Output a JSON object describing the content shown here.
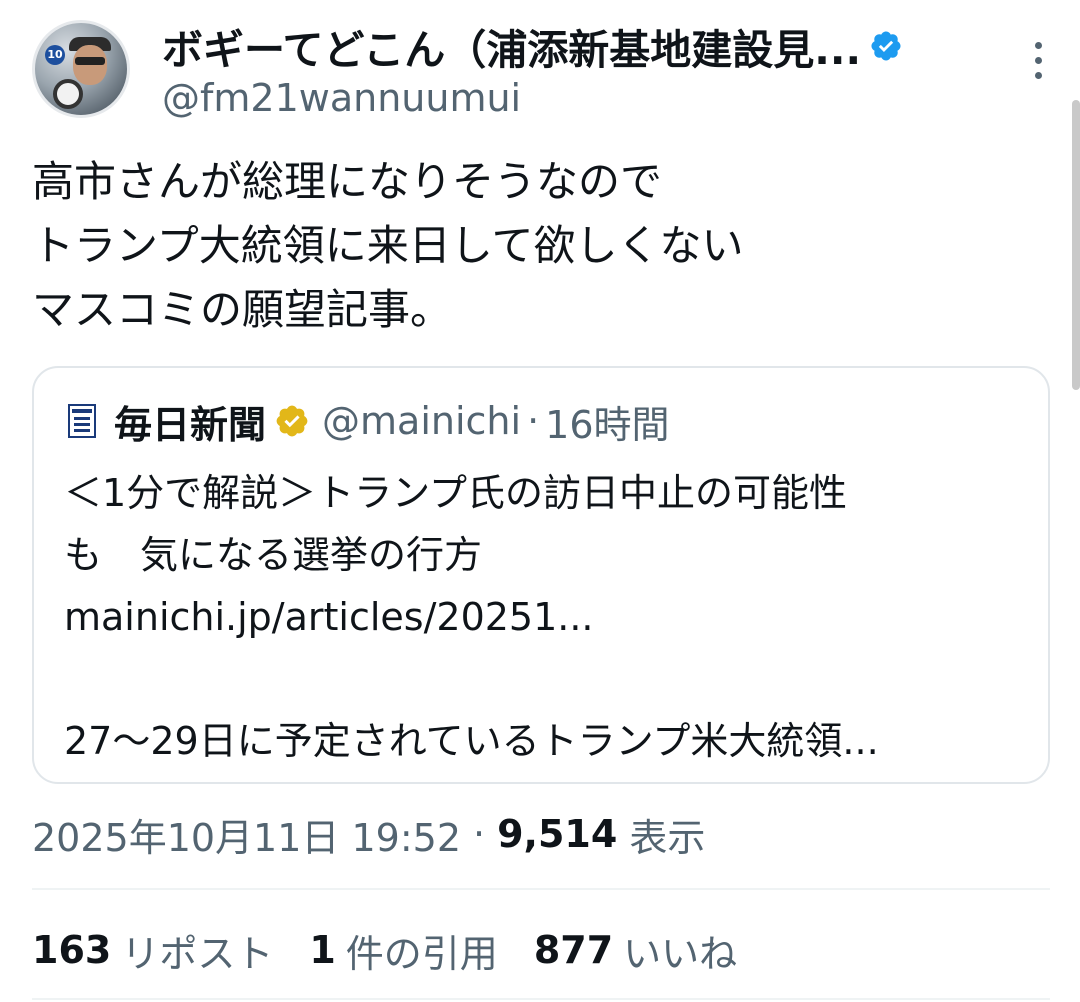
{
  "author": {
    "display_name": "ボギーてどこん（浦添新基地建設見...",
    "handle": "@fm21wannuumui",
    "avatar_badge": "10"
  },
  "tweet": {
    "lines": [
      "高市さんが総理になりそうなので",
      "トランプ大統領に来日して欲しくない",
      "マスコミの願望記事。"
    ]
  },
  "quote": {
    "name": "毎日新聞",
    "handle": "@mainichi",
    "dot": "·",
    "time": "16時間",
    "lines": [
      "＜1分で解説＞トランプ氏の訪日中止の可能性",
      "も　気になる選挙の行方",
      "mainichi.jp/articles/20251...",
      "",
      "27〜29日に予定されているトランプ米大統領..."
    ]
  },
  "meta": {
    "datetime": "2025年10月11日 19:52",
    "sep": "·",
    "views_count": "9,514",
    "views_label": "表示"
  },
  "stats": {
    "reposts_count": "163",
    "reposts_label": "リポスト",
    "quotes_count": "1",
    "quotes_label": "件の引用",
    "likes_count": "877",
    "likes_label": "いいね"
  },
  "colors": {
    "verified_blue": "#1d9bf0",
    "verified_gold": "#e2b719",
    "text_primary": "#0f1419",
    "text_secondary": "#536471"
  },
  "icons": [
    "verified-badge-icon",
    "more-options-icon",
    "mainichi-logo-icon",
    "gold-verified-badge-icon"
  ]
}
